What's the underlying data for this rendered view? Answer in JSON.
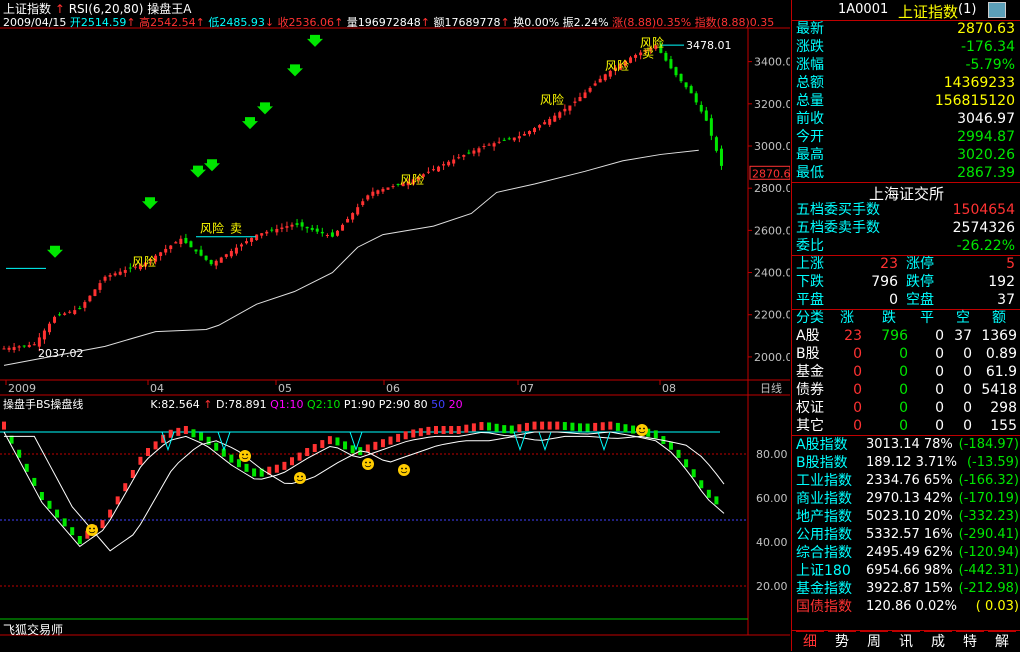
{
  "header": {
    "line1": {
      "name": "上证指数",
      "indicator": "RSI(6,20,80)",
      "tool": "操盘王A"
    },
    "line2": {
      "date": "2009/04/15",
      "open": "开2514.59",
      "high": "高2542.54",
      "low": "低2485.93",
      "close": "收2536.06",
      "vol": "量196972848",
      "amt": "额17689778",
      "turnover": "换0.00%",
      "amplitude": "振2.24%",
      "change": "涨(8.88)0.35%",
      "index": "指数(8.88)0.35"
    }
  },
  "main_chart": {
    "price_labels": [
      "3400.0",
      "3200.0",
      "3000.0",
      "2800.0",
      "2600.0",
      "2400.0",
      "2200.0",
      "2000.0"
    ],
    "current_price": "2870.6",
    "high_label": "3478.01",
    "low_label": "2037.02",
    "risk_label": "风险",
    "sell_label": "卖",
    "x_labels": [
      "2009",
      "04",
      "05",
      "06",
      "07",
      "08"
    ],
    "x_axis_name": "日线"
  },
  "sub_chart": {
    "name": "操盘手BS操盘线",
    "k": "K:82.564",
    "d": "D:78.891",
    "q1": "Q1:10",
    "q2": "Q2:10",
    "p1": "P1:90",
    "p2": "P2:90",
    "v80": "80",
    "v50": "50",
    "v20": "20",
    "y_labels": [
      "80.00",
      "60.00",
      "40.00",
      "20.00"
    ],
    "footer": "飞狐交易师"
  },
  "quote_panel": {
    "code": "1A0001",
    "name": "上证指数",
    "suffix": "(1)",
    "rows": [
      {
        "label": "最新",
        "value": "2870.63"
      },
      {
        "label": "涨跌",
        "value": "-176.34"
      },
      {
        "label": "涨幅",
        "value": "-5.79%"
      },
      {
        "label": "总额",
        "value": "14369233"
      },
      {
        "label": "总量",
        "value": "156815120"
      },
      {
        "label": "前收",
        "value": "3046.97"
      },
      {
        "label": "今开",
        "value": "2994.87"
      },
      {
        "label": "最高",
        "value": "3020.26"
      },
      {
        "label": "最低",
        "value": "2867.39"
      }
    ],
    "exchange": "上海证交所",
    "buy_label": "五档委买手数",
    "buy_value": "1504654",
    "sell_label": "五档委卖手数",
    "sell_value": "2574326",
    "ratio_label": "委比",
    "ratio_value": "-26.22%",
    "breadth": {
      "up": "上涨",
      "up_v": "23",
      "limit_up": "涨停",
      "limit_up_v": "5",
      "down": "下跌",
      "down_v": "796",
      "limit_down": "跌停",
      "limit_down_v": "192",
      "flat": "平盘",
      "flat_v": "0",
      "halt": "空盘",
      "halt_v": "37"
    },
    "class_header": [
      "分类",
      "涨",
      "跌",
      "平",
      "空",
      "额"
    ],
    "class_rows": [
      {
        "name": "A股",
        "up": "23",
        "down": "796",
        "flat": "0",
        "halt": "37",
        "amt": "1369"
      },
      {
        "name": "B股",
        "up": "0",
        "down": "0",
        "flat": "0",
        "halt": "0",
        "amt": "0.89"
      },
      {
        "name": "基金",
        "up": "0",
        "down": "0",
        "flat": "0",
        "halt": "0",
        "amt": "61.9"
      },
      {
        "name": "债券",
        "up": "0",
        "down": "0",
        "flat": "0",
        "halt": "0",
        "amt": "5418"
      },
      {
        "name": "权证",
        "up": "0",
        "down": "0",
        "flat": "0",
        "halt": "0",
        "amt": "298"
      },
      {
        "name": "其它",
        "up": "0",
        "down": "0",
        "flat": "0",
        "halt": "0",
        "amt": "155"
      }
    ],
    "indices": [
      {
        "name": "A股指数",
        "value": "3013.14",
        "pct": "78%",
        "chg": "(-184.97)"
      },
      {
        "name": "B股指数",
        "value": "189.12",
        "pct": "3.71%",
        "chg": "(-13.59)"
      },
      {
        "name": "工业指数",
        "value": "2334.76",
        "pct": "65%",
        "chg": "(-166.32)"
      },
      {
        "name": "商业指数",
        "value": "2970.13",
        "pct": "42%",
        "chg": "(-170.19)"
      },
      {
        "name": "地产指数",
        "value": "5023.10",
        "pct": "20%",
        "chg": "(-332.23)"
      },
      {
        "name": "公用指数",
        "value": "5332.57",
        "pct": "16%",
        "chg": "(-290.41)"
      },
      {
        "name": "综合指数",
        "value": "2495.49",
        "pct": "62%",
        "chg": "(-120.94)"
      },
      {
        "name": "上证180",
        "value": "6954.66",
        "pct": "98%",
        "chg": "(-442.31)"
      },
      {
        "name": "基金指数",
        "value": "3922.87",
        "pct": "15%",
        "chg": "(-212.98)"
      },
      {
        "name": "国债指数",
        "value": "120.86",
        "pct": "0.02%",
        "chg": "( 0.03)"
      }
    ],
    "tabs": [
      "细",
      "势",
      "周",
      "讯",
      "成",
      "特",
      "解"
    ]
  },
  "colors": {
    "up": "#ff3232",
    "down": "#00e600",
    "axis": "#c00000",
    "label": "#00ffff"
  },
  "chart_data": {
    "type": "candlestick",
    "y_range": [
      1900,
      3550
    ],
    "x_ticks": [
      "2009",
      "04",
      "05",
      "06",
      "07",
      "08"
    ],
    "trend": [
      [
        0,
        2040
      ],
      [
        12,
        2060
      ],
      [
        20,
        2190
      ],
      [
        30,
        2230
      ],
      [
        40,
        2380
      ],
      [
        55,
        2440
      ],
      [
        70,
        2560
      ],
      [
        82,
        2440
      ],
      [
        100,
        2580
      ],
      [
        115,
        2630
      ],
      [
        130,
        2570
      ],
      [
        145,
        2780
      ],
      [
        160,
        2830
      ],
      [
        175,
        2920
      ],
      [
        190,
        3000
      ],
      [
        205,
        3050
      ],
      [
        215,
        3120
      ],
      [
        225,
        3200
      ],
      [
        238,
        3340
      ],
      [
        248,
        3420
      ],
      [
        258,
        3478
      ],
      [
        265,
        3350
      ],
      [
        272,
        3250
      ],
      [
        278,
        3120
      ],
      [
        285,
        2870
      ]
    ],
    "baseline": [
      [
        0,
        1960
      ],
      [
        40,
        2050
      ],
      [
        60,
        2120
      ],
      [
        80,
        2130
      ],
      [
        85,
        2150
      ],
      [
        100,
        2250
      ],
      [
        115,
        2310
      ],
      [
        130,
        2400
      ],
      [
        140,
        2520
      ],
      [
        150,
        2580
      ],
      [
        170,
        2620
      ],
      [
        185,
        2680
      ],
      [
        195,
        2780
      ],
      [
        210,
        2820
      ],
      [
        230,
        2880
      ],
      [
        245,
        2930
      ],
      [
        260,
        2960
      ],
      [
        275,
        2980
      ]
    ],
    "sub_k": [
      [
        0,
        92
      ],
      [
        15,
        60
      ],
      [
        30,
        40
      ],
      [
        40,
        48
      ],
      [
        55,
        78
      ],
      [
        65,
        88
      ],
      [
        72,
        90
      ],
      [
        80,
        86
      ],
      [
        90,
        77
      ],
      [
        100,
        70
      ],
      [
        110,
        73
      ],
      [
        120,
        80
      ],
      [
        130,
        86
      ],
      [
        140,
        80
      ],
      [
        150,
        84
      ],
      [
        160,
        88
      ],
      [
        170,
        90
      ],
      [
        180,
        90
      ],
      [
        190,
        92
      ],
      [
        200,
        90
      ],
      [
        210,
        92
      ],
      [
        220,
        92
      ],
      [
        230,
        91
      ],
      [
        240,
        92
      ],
      [
        250,
        90
      ],
      [
        258,
        88
      ],
      [
        265,
        82
      ],
      [
        272,
        72
      ],
      [
        278,
        62
      ],
      [
        285,
        55
      ]
    ]
  }
}
